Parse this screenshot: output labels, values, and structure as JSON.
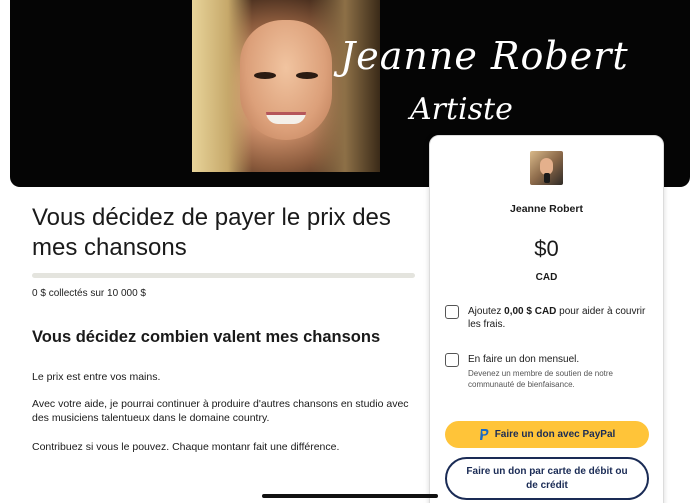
{
  "banner": {
    "signature_name": "Jeanne Robert",
    "signature_title": "Artiste"
  },
  "campaign": {
    "title": "Vous décidez de payer le prix des mes chansons",
    "progress_fraction": 0,
    "raised_amount": "0 $",
    "raised_label": "collectés sur",
    "goal_amount": "10 000 $",
    "section_title": "Vous décidez combien valent mes chansons",
    "paragraphs": [
      "Le prix est entre vos mains.",
      "Avec votre aide, je pourrai continuer à produire d'autres chansons en studio avec des musiciens talentueux dans le domaine country.",
      "Contribuez si vous le pouvez. Chaque montanr fait une différence."
    ]
  },
  "donation": {
    "org_name": "Jeanne Robert",
    "amount": "$0",
    "currency": "CAD",
    "fee_prefix": "Ajoutez",
    "fee_amount": "0,00 $ CAD",
    "fee_suffix": "pour aider à couvrir les frais.",
    "monthly_label": "En faire un don mensuel.",
    "monthly_sub": "Devenez un membre de soutien de notre communauté de bienfaisance.",
    "paypal_label": "Faire un don avec PayPal",
    "paypal_icon": "paypal-icon",
    "card_label": "Faire un don par carte de débit ou de crédit",
    "colors": {
      "paypal": "#ffc439",
      "primary": "#1a2b55",
      "progress": "#2b7a3d"
    }
  }
}
